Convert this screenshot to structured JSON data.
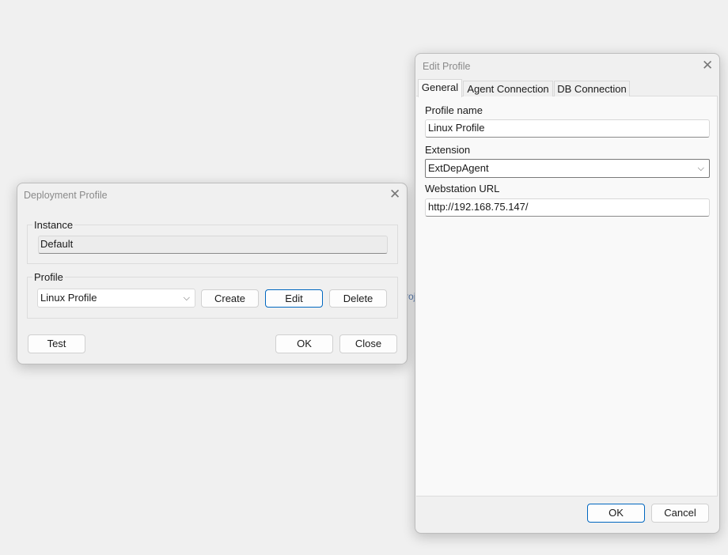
{
  "background": {
    "fragment_text": "roj"
  },
  "deployment": {
    "title": "Deployment Profile",
    "instance_label": "Instance",
    "instance_value": "Default",
    "profile_label": "Profile",
    "profile_value": "Linux Profile",
    "create": "Create",
    "edit": "Edit",
    "delete": "Delete",
    "test": "Test",
    "ok": "OK",
    "close": "Close"
  },
  "edit": {
    "title": "Edit Profile",
    "tabs": [
      "General",
      "Agent Connection",
      "DB Connection"
    ],
    "profile_name_label": "Profile name",
    "profile_name_value": "Linux Profile",
    "extension_label": "Extension",
    "extension_value": "ExtDepAgent",
    "url_label": "Webstation URL",
    "url_value": "http://192.168.75.147/",
    "ok": "OK",
    "cancel": "Cancel"
  },
  "icons": {
    "close": "✕",
    "chevron": "⌵"
  }
}
